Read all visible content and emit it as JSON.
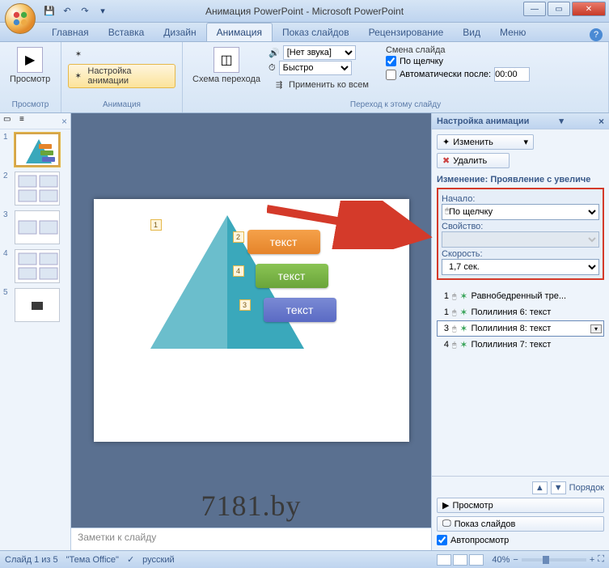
{
  "window": {
    "title": "Анимация PowerPoint - Microsoft PowerPoint"
  },
  "tabs": {
    "home": "Главная",
    "insert": "Вставка",
    "design": "Дизайн",
    "animation": "Анимация",
    "slideshow": "Показ слайдов",
    "review": "Рецензирование",
    "view": "Вид",
    "menu": "Меню"
  },
  "ribbon": {
    "preview": {
      "label": "Просмотр",
      "group": "Просмотр"
    },
    "anim": {
      "custom": "Настройка анимации",
      "group": "Анимация"
    },
    "scheme": {
      "btn": "Схема перехода",
      "sound_none": "[Нет звука]",
      "speed": "Быстро",
      "apply_all": "Применить ко всем"
    },
    "transition": {
      "group": "Переход к этому слайду",
      "title": "Смена слайда",
      "on_click": "По щелчку",
      "auto_after": "Автоматически после:",
      "time": "00:00"
    }
  },
  "slide": {
    "text1": "текст",
    "text2": "текст",
    "text3": "текст",
    "tag1": "1",
    "tag2": "2",
    "tag3": "3",
    "tag4": "4",
    "watermark": "7181.by"
  },
  "notes": {
    "placeholder": "Заметки к слайду"
  },
  "thumbs": {
    "n1": "1",
    "n2": "2",
    "n3": "3",
    "n4": "4",
    "n5": "5"
  },
  "taskpane": {
    "title": "Настройка анимации",
    "change": "Изменить",
    "remove": "Удалить",
    "change_title": "Изменение: Проявление с увеличе",
    "start_label": "Начало:",
    "start_value": "По щелчку",
    "property_label": "Свойство:",
    "speed_label": "Скорость:",
    "speed_value": "1,7 сек.",
    "items": [
      {
        "n": "1",
        "label": "Равнобедренный тре..."
      },
      {
        "n": "1",
        "label": "Полилиния 6: текст"
      },
      {
        "n": "3",
        "label": "Полилиния 8: текст"
      },
      {
        "n": "4",
        "label": "Полилиния 7: текст"
      }
    ],
    "reorder": "Порядок",
    "preview": "Просмотр",
    "slideshow": "Показ слайдов",
    "autopreview": "Автопросмотр"
  },
  "status": {
    "slide": "Слайд 1 из 5",
    "theme": "\"Тема Office\"",
    "lang": "русский",
    "zoom": "40%"
  }
}
